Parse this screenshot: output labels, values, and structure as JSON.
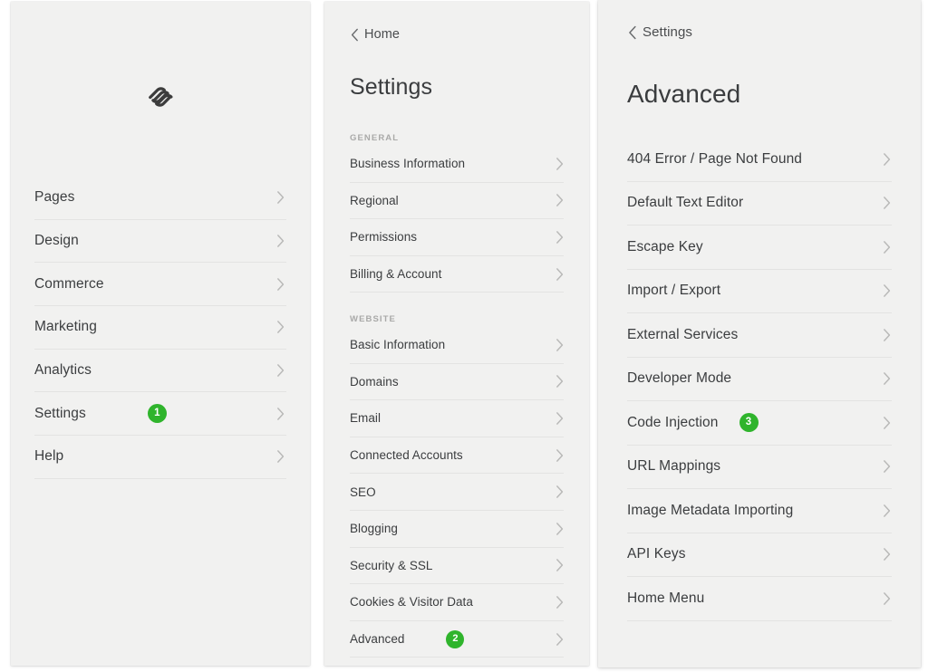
{
  "colors": {
    "panel_bg": "#f1f1f0",
    "page_bg": "#ffffff",
    "text": "#3b3d3f",
    "muted": "#a9a9a8",
    "divider": "#e3e3e2",
    "badge_green": "#2fb42c",
    "chevron": "#b9b9b8"
  },
  "panel_pages": {
    "logo_name": "squarespace-logo",
    "items": [
      {
        "label": "Pages",
        "badge": null
      },
      {
        "label": "Design",
        "badge": null
      },
      {
        "label": "Commerce",
        "badge": null
      },
      {
        "label": "Marketing",
        "badge": null
      },
      {
        "label": "Analytics",
        "badge": null
      },
      {
        "label": "Settings",
        "badge": "1"
      },
      {
        "label": "Help",
        "badge": null
      }
    ]
  },
  "panel_settings": {
    "back_label": "Home",
    "title": "Settings",
    "sections": [
      {
        "heading": "GENERAL",
        "items": [
          {
            "label": "Business Information",
            "badge": null
          },
          {
            "label": "Regional",
            "badge": null
          },
          {
            "label": "Permissions",
            "badge": null
          },
          {
            "label": "Billing & Account",
            "badge": null
          }
        ]
      },
      {
        "heading": "WEBSITE",
        "items": [
          {
            "label": "Basic Information",
            "badge": null
          },
          {
            "label": "Domains",
            "badge": null
          },
          {
            "label": "Email",
            "badge": null
          },
          {
            "label": "Connected Accounts",
            "badge": null
          },
          {
            "label": "SEO",
            "badge": null
          },
          {
            "label": "Blogging",
            "badge": null
          },
          {
            "label": "Security & SSL",
            "badge": null
          },
          {
            "label": "Cookies & Visitor Data",
            "badge": null
          },
          {
            "label": "Advanced",
            "badge": "2"
          }
        ]
      }
    ]
  },
  "panel_advanced": {
    "back_label": "Settings",
    "title": "Advanced",
    "items": [
      {
        "label": "404 Error / Page Not Found",
        "badge": null
      },
      {
        "label": "Default Text Editor",
        "badge": null
      },
      {
        "label": "Escape Key",
        "badge": null
      },
      {
        "label": "Import / Export",
        "badge": null
      },
      {
        "label": "External Services",
        "badge": null
      },
      {
        "label": "Developer Mode",
        "badge": null
      },
      {
        "label": "Code Injection",
        "badge": "3"
      },
      {
        "label": "URL Mappings",
        "badge": null
      },
      {
        "label": "Image Metadata Importing",
        "badge": null
      },
      {
        "label": "API Keys",
        "badge": null
      },
      {
        "label": "Home Menu",
        "badge": null
      }
    ]
  }
}
